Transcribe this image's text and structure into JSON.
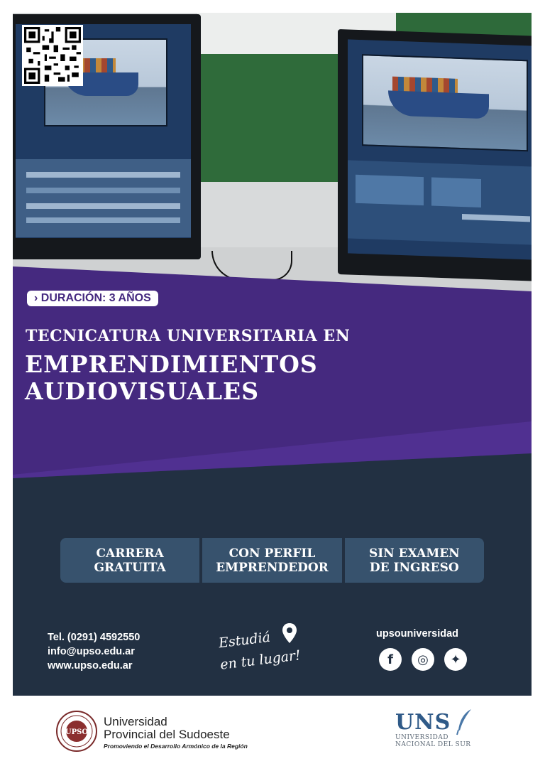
{
  "colors": {
    "purple": "#45297f",
    "navy": "#223042",
    "feature_bg": "#37526d",
    "uns_blue": "#2f5a88"
  },
  "badge": "› DURACIÓN: 3 AÑOS",
  "subtitle": "TECNICATURA UNIVERSITARIA EN",
  "title": {
    "line1": "EMPRENDIMIENTOS",
    "line2": "AUDIOVISUALES"
  },
  "features": [
    {
      "line1": "CARRERA",
      "line2": "GRATUITA"
    },
    {
      "line1": "CON PERFIL",
      "line2": "EMPRENDEDOR"
    },
    {
      "line1": "SIN EXAMEN",
      "line2": "DE INGRESO"
    }
  ],
  "contact": {
    "phone": "Tel. (0291) 4592550",
    "email": "info@upso.edu.ar",
    "web": "www.upso.edu.ar"
  },
  "slogan": {
    "line1": "Estudiá",
    "line2": "en tu lugar!"
  },
  "social": {
    "handle": "upsouniversidad",
    "icons": [
      {
        "name": "facebook-icon",
        "glyph": "f"
      },
      {
        "name": "instagram-icon",
        "glyph": "◎"
      },
      {
        "name": "twitter-icon",
        "glyph": "✦"
      }
    ]
  },
  "upso": {
    "line1": "Universidad",
    "line2": "Provincial del Sudoeste",
    "tagline": "Promoviendo el Desarrollo Armónico de la Región",
    "seal": "UPSO"
  },
  "uns": {
    "abbr": "UNS",
    "line1": "UNIVERSIDAD",
    "line2": "NACIONAL DEL SUR"
  }
}
